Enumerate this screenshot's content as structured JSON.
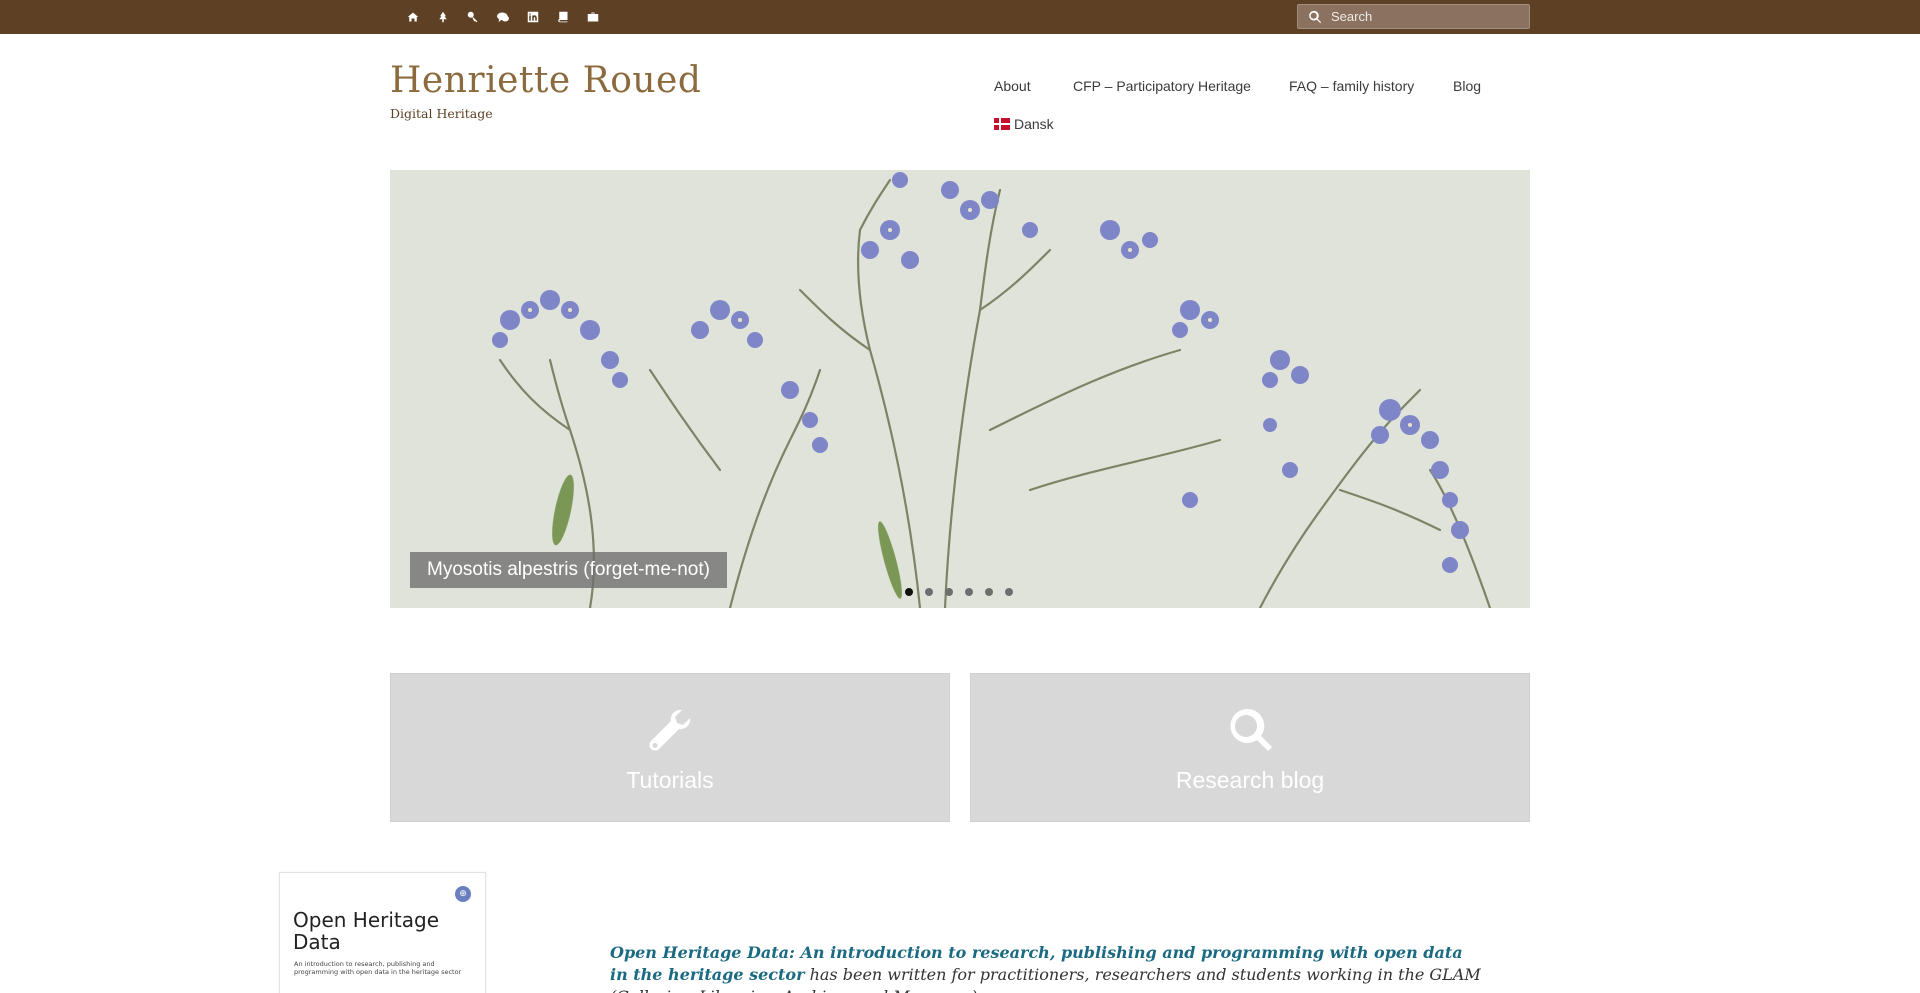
{
  "topbar": {
    "icons": [
      "home-icon",
      "tree-icon",
      "key-icon",
      "chat-icon",
      "linkedin-icon",
      "book-icon",
      "briefcase-icon"
    ],
    "search_placeholder": "Search"
  },
  "header": {
    "title": "Henriette Roued",
    "tagline": "Digital Heritage"
  },
  "nav": {
    "items": [
      {
        "label": "About"
      },
      {
        "label": "CFP – Participatory Heritage"
      },
      {
        "label": "FAQ – family history"
      },
      {
        "label": "Blog"
      }
    ],
    "language": "Dansk"
  },
  "slider": {
    "caption": "Myosotis alpestris (forget-me-not)",
    "slide_count": 6,
    "active_slide": 1
  },
  "features": [
    {
      "label": "Tutorials",
      "icon": "wrench-icon"
    },
    {
      "label": "Research blog",
      "icon": "search-icon"
    }
  ],
  "book": {
    "title": "Open Heritage Data",
    "subtitle": "An introduction to research, publishing and programming with open data in the heritage sector"
  },
  "intro": {
    "link_text": "Open Heritage Data: An introduction to research, publishing and programming with open data in the heritage sector",
    "text": " has been written for practitioners, researchers and students working in the GLAM (Galleries, Libraries, Archives and Museums)"
  },
  "colors": {
    "topbar": "#5e4024",
    "title": "#8b6a3e",
    "link": "#1b6a82",
    "feature_bg": "#d8d8d8"
  }
}
